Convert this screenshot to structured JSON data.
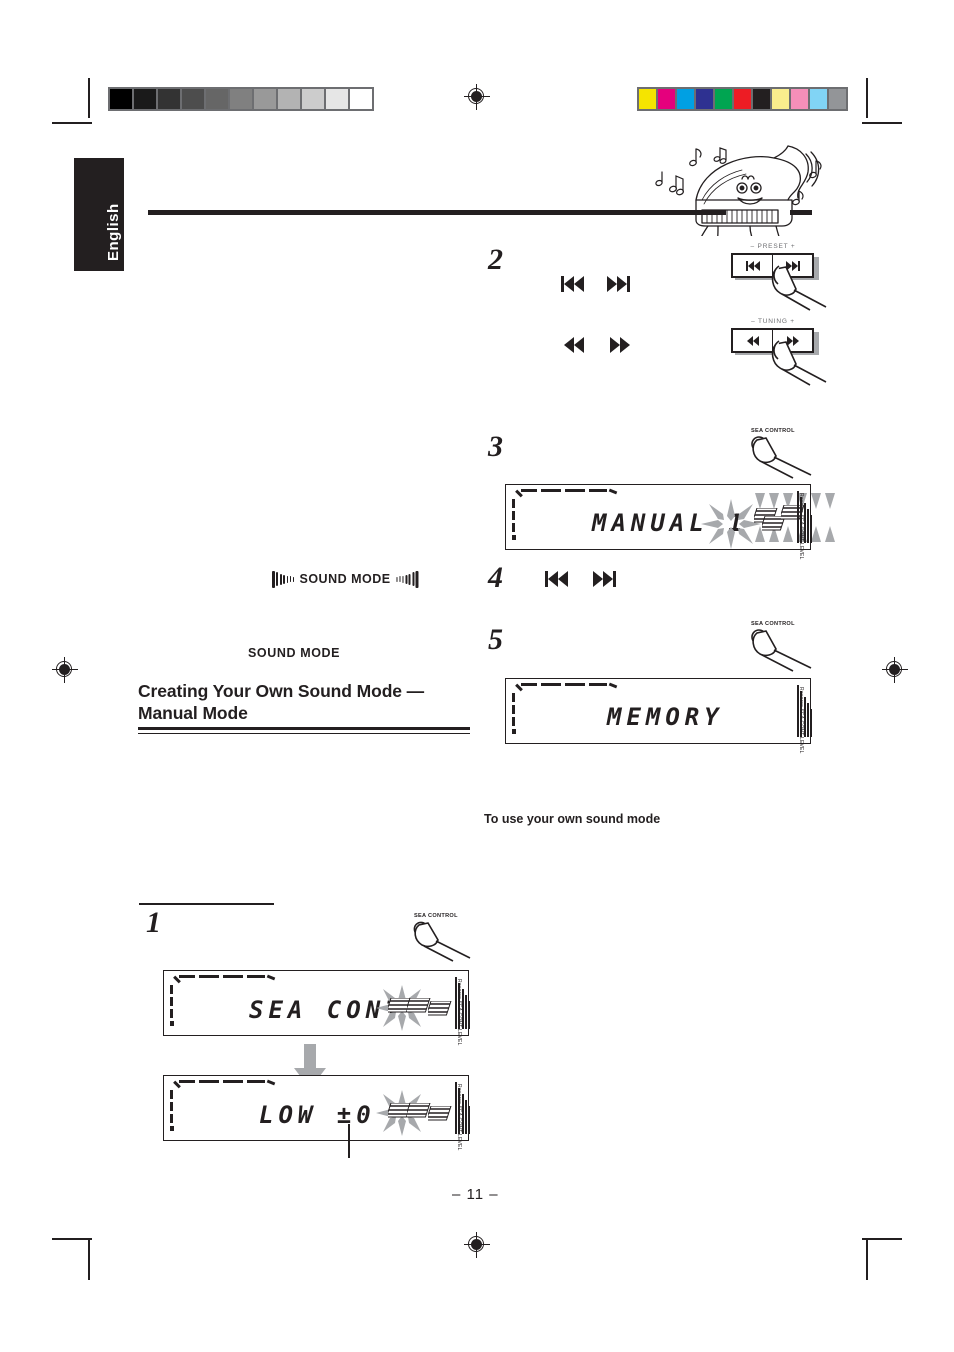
{
  "page": {
    "language_tab": "English",
    "page_number": "– 11 –"
  },
  "calibration": {
    "gray_label": "grayscale-calibration-bar",
    "gray_swatches": [
      "#000000",
      "#1a1a1a",
      "#333333",
      "#4d4d4d",
      "#666666",
      "#808080",
      "#999999",
      "#b3b3b3",
      "#cccccc",
      "#e6e6e6",
      "#ffffff"
    ],
    "color_label": "color-calibration-bar",
    "color_swatches": [
      "#f5e400",
      "#e5007d",
      "#00a0e3",
      "#2e3191",
      "#00a551",
      "#ed1c24",
      "#231f20",
      "#faed8d",
      "#f58fb9",
      "#81d4f5",
      "#939598"
    ]
  },
  "illustration": {
    "name": "cartoon-grand-piano"
  },
  "sound_mode_button": {
    "label": "SOUND MODE"
  },
  "sound_mode_caption": "SOUND MODE",
  "section": {
    "heading": "Creating Your Own Sound Mode — Manual Mode",
    "subheading": "To use your own sound mode"
  },
  "steps": [
    {
      "number": "2",
      "controls": [
        {
          "name": "preset",
          "caption": "– PRESET +",
          "left_glyph": "skip-back",
          "right_glyph": "skip-forward"
        },
        {
          "name": "tuning",
          "caption": "– TUNING +",
          "left_glyph": "rewind",
          "right_glyph": "fast-forward"
        }
      ]
    },
    {
      "number": "3",
      "button_caption": "SEA CONTROL",
      "display": "MANUAL 1"
    },
    {
      "number": "4",
      "glyphs": [
        "skip-back",
        "skip-forward"
      ]
    },
    {
      "number": "5",
      "button_caption": "SEA CONTROL",
      "display": "MEMORY"
    },
    {
      "number": "1",
      "button_caption": "SEA CONTROL",
      "display_first": "SEA CONT",
      "display_second": "LOW ±0"
    }
  ],
  "display_vertical_label": "Reverse  SEA CONT  LEVEL",
  "colors": {
    "ink": "#231f20",
    "gray": "#a7a9ac",
    "midgray": "#6d6e71"
  }
}
